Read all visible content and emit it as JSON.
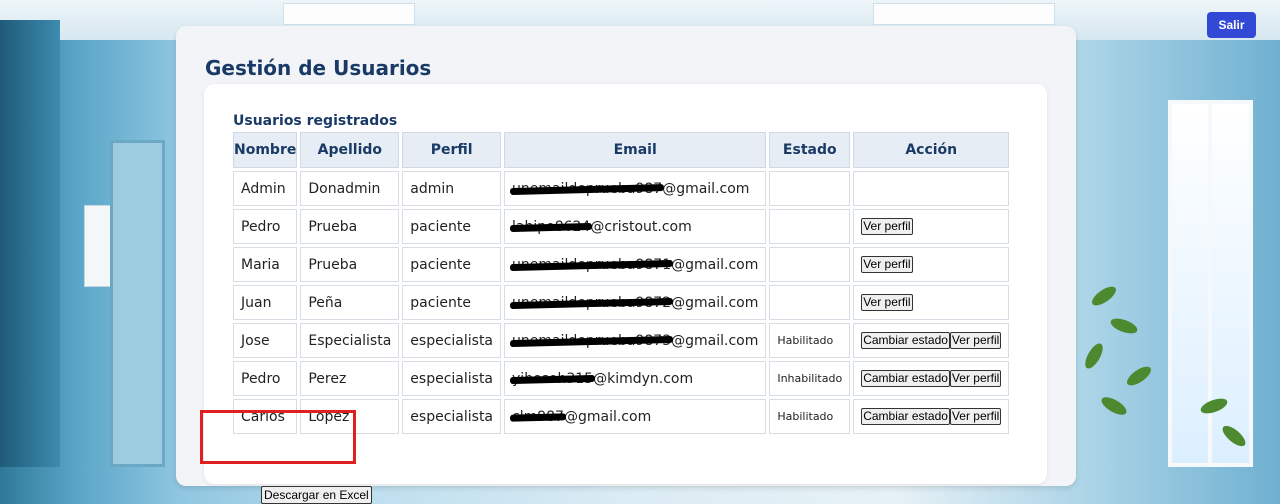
{
  "header": {
    "logout_label": "Salir"
  },
  "page": {
    "title": "Gestión de Usuarios",
    "subtitle": "Usuarios registrados"
  },
  "table": {
    "columns": [
      "Nombre",
      "Apellido",
      "Perfil",
      "Email",
      "Estado",
      "Acción"
    ],
    "rows": [
      {
        "nombre": "Admin",
        "apellido": "Donadmin",
        "perfil": "admin",
        "email_hidden": "unemaildeprueba987",
        "email_visible": "@gmail.com",
        "estado": "",
        "actions": []
      },
      {
        "nombre": "Pedro",
        "apellido": "Prueba",
        "perfil": "paciente",
        "email_hidden": "labipo8624",
        "email_visible": "@cristout.com",
        "estado": "",
        "actions": [
          "Ver perfil"
        ]
      },
      {
        "nombre": "Maria",
        "apellido": "Prueba",
        "perfil": "paciente",
        "email_hidden": "unemaildeprueba9871",
        "email_visible": "@gmail.com",
        "estado": "",
        "actions": [
          "Ver perfil"
        ]
      },
      {
        "nombre": "Juan",
        "apellido": "Peña",
        "perfil": "paciente",
        "email_hidden": "unemaildeprueba9872",
        "email_visible": "@gmail.com",
        "estado": "",
        "actions": [
          "Ver perfil"
        ]
      },
      {
        "nombre": "Jose",
        "apellido": "Especialista",
        "perfil": "especialista",
        "email_hidden": "unemaildeprueba9873",
        "email_visible": "@gmail.com",
        "estado": "Habilitado",
        "actions": [
          "Cambiar estado",
          "Ver perfil"
        ]
      },
      {
        "nombre": "Pedro",
        "apellido": "Perez",
        "perfil": "especialista",
        "email_hidden": "yihosoh315",
        "email_visible": "@kimdyn.com",
        "estado": "Inhabilitado",
        "actions": [
          "Cambiar estado",
          "Ver perfil"
        ]
      },
      {
        "nombre": "Carlos",
        "apellido": "Lopez",
        "perfil": "especialista",
        "email_hidden": "clm987",
        "email_visible": "@gmail.com",
        "estado": "Habilitado",
        "actions": [
          "Cambiar estado",
          "Ver perfil"
        ]
      }
    ]
  },
  "export": {
    "excel_label": "Descargar en Excel"
  },
  "colors": {
    "accent": "#3249d6",
    "title": "#1a3a66",
    "highlight": "#e02020"
  }
}
